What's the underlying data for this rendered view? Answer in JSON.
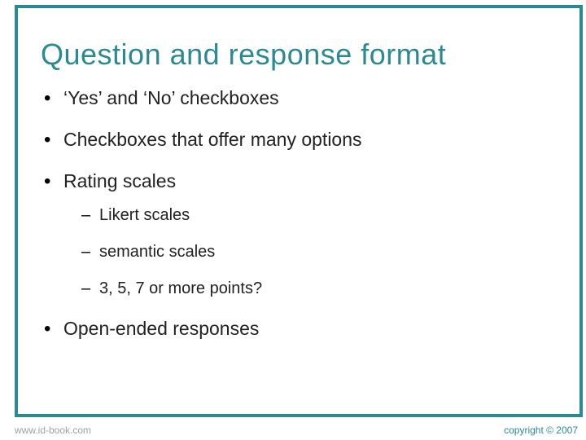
{
  "title": "Question and response format",
  "bullets": {
    "b1": "‘Yes’ and ‘No’ checkboxes",
    "b2": "Checkboxes that offer many options",
    "b3": "Rating scales",
    "b3_sub": {
      "s1": "Likert scales",
      "s2": "semantic scales",
      "s3": "3, 5, 7 or more points?"
    },
    "b4": "Open-ended responses"
  },
  "footer": {
    "left": "www.id-book.com",
    "right": "copyright © 2007"
  }
}
